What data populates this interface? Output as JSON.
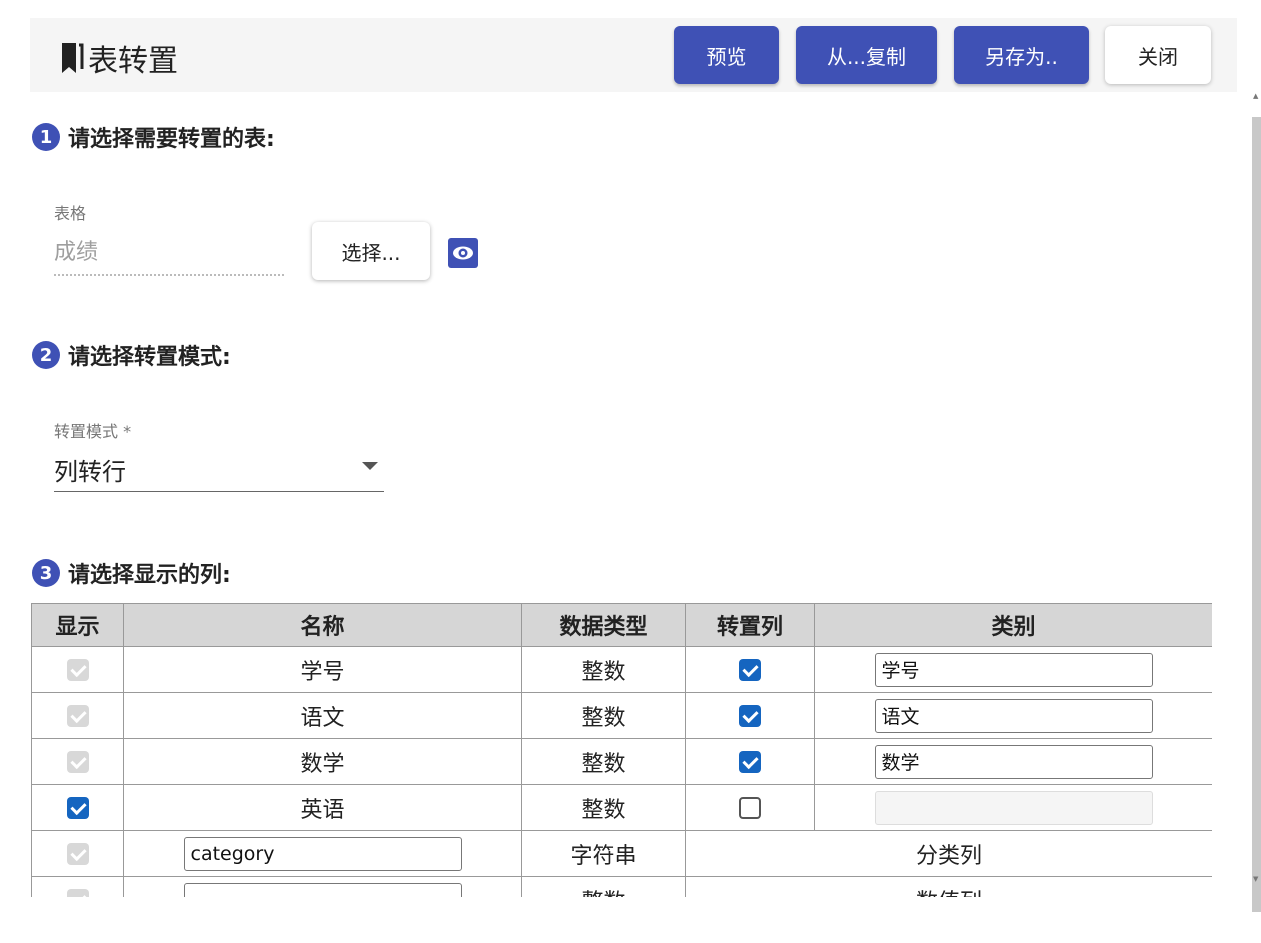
{
  "header": {
    "title": "表转置",
    "buttons": {
      "preview": "预览",
      "copy_from": "从...复制",
      "save_as": "另存为..",
      "close": "关闭"
    }
  },
  "step1": {
    "number": "1",
    "title": "请选择需要转置的表:",
    "field_label": "表格",
    "field_value": "成绩",
    "select_button": "选择..."
  },
  "step2": {
    "number": "2",
    "title": "请选择转置模式:",
    "field_label": "转置模式 *",
    "field_value": "列转行"
  },
  "step3": {
    "number": "3",
    "title": "请选择显示的列:",
    "columns": {
      "show": "显示",
      "name": "名称",
      "type": "数据类型",
      "transpose": "转置列",
      "category": "类别"
    },
    "rows": [
      {
        "name": "学号",
        "type": "整数",
        "category": "学号"
      },
      {
        "name": "语文",
        "type": "整数",
        "category": "语文"
      },
      {
        "name": "数学",
        "type": "整数",
        "category": "数学"
      },
      {
        "name": "英语",
        "type": "整数",
        "category": ""
      }
    ],
    "extra_rows": [
      {
        "name_input": "category",
        "type": "字符串",
        "role": "分类列"
      },
      {
        "name_input": "",
        "type": "整数",
        "role": "数值列"
      }
    ]
  },
  "colors": {
    "primary": "#3f51b5",
    "checkbox": "#1565c0"
  }
}
